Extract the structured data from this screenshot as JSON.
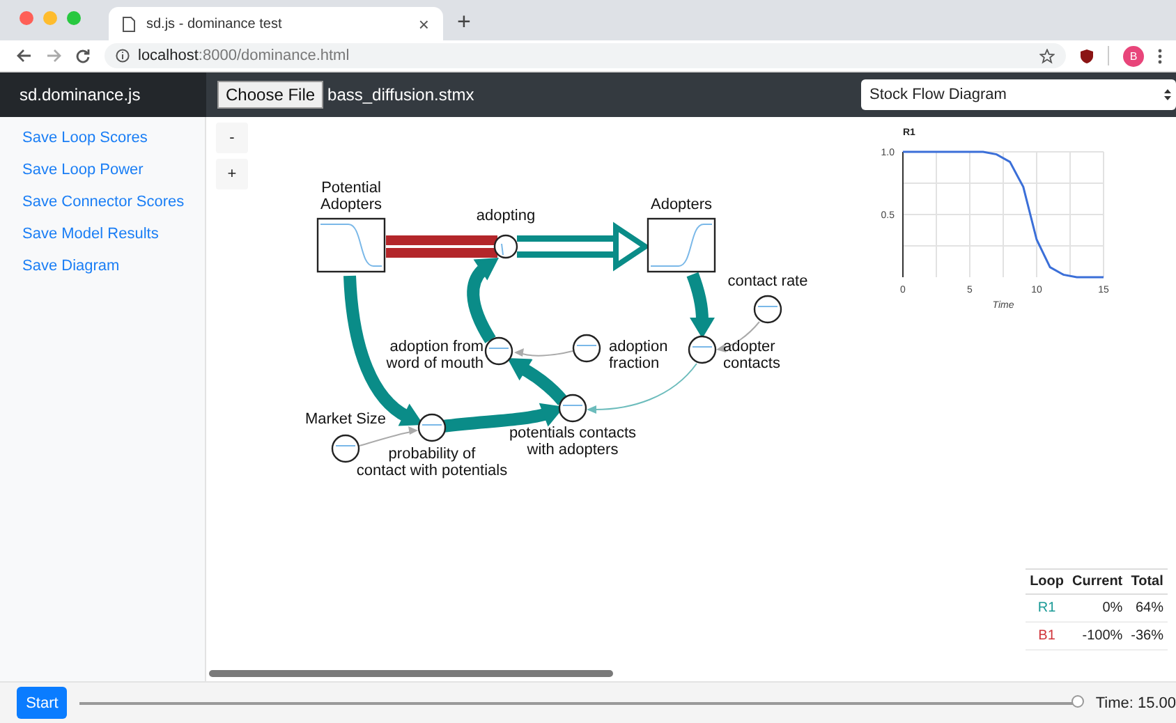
{
  "browser": {
    "tab": {
      "title": "sd.js - dominance test",
      "close": "×"
    },
    "new_tab": "+",
    "url": {
      "host": "localhost",
      "path": ":8000/dominance.html"
    },
    "profile": "B"
  },
  "header": {
    "brand": "sd.dominance.js",
    "file_button": "Choose File",
    "file_name": "bass_diffusion.stmx",
    "view_select": "Stock Flow Diagram"
  },
  "sidebar": {
    "links": [
      "Save Loop Scores",
      "Save Loop Power",
      "Save Connector Scores",
      "Save Model Results",
      "Save Diagram"
    ]
  },
  "zoom_buttons": [
    "-",
    "+"
  ],
  "diagram": {
    "nodes": [
      {
        "kind": "stock",
        "label": "Potential\nAdopters"
      },
      {
        "kind": "flow",
        "label": "adopting"
      },
      {
        "kind": "stock",
        "label": "Adopters"
      },
      {
        "kind": "aux",
        "label": "contact rate"
      },
      {
        "kind": "aux",
        "label": "adoption from\nword of mouth"
      },
      {
        "kind": "aux",
        "label": "adoption\nfraction"
      },
      {
        "kind": "aux",
        "label": "adopter\ncontacts"
      },
      {
        "kind": "aux",
        "label": "Market Size"
      },
      {
        "kind": "aux",
        "label": "probability of\ncontact with potentials"
      },
      {
        "kind": "aux",
        "label": "potentials contacts\nwith adopters"
      }
    ]
  },
  "chart": {
    "chart_data": {
      "type": "line",
      "title": "R1",
      "xlabel": "Time",
      "x": [
        0,
        1,
        2,
        3,
        4,
        5,
        6,
        7,
        8,
        9,
        10,
        11,
        12,
        13,
        14,
        15
      ],
      "series": [
        {
          "color": "#3b6fd8",
          "values": [
            1,
            1,
            1,
            1,
            1,
            1,
            1,
            0.98,
            0.92,
            0.72,
            0.3,
            0.08,
            0.02,
            0,
            0,
            0
          ]
        }
      ],
      "grid": true,
      "xlim": [
        0,
        15
      ],
      "ylim": [
        0,
        1
      ],
      "xticks": [
        0,
        5,
        10,
        15
      ],
      "yticks": [
        {
          "value": 0.5,
          "label": "0.5"
        },
        {
          "value": 1,
          "label": "1.0"
        }
      ]
    }
  },
  "loop_table": {
    "columns": [
      "Loop",
      "Current",
      "Total"
    ],
    "rows": [
      {
        "loop": "R1",
        "color": "#1a9a96",
        "current": "0%",
        "total": "64%"
      },
      {
        "loop": "B1",
        "color": "#d0343a",
        "current": "-100%",
        "total": "-36%"
      }
    ]
  },
  "footer": {
    "start": "Start",
    "time_slider": {
      "level": 1
    },
    "time": "Time: 15.00"
  }
}
